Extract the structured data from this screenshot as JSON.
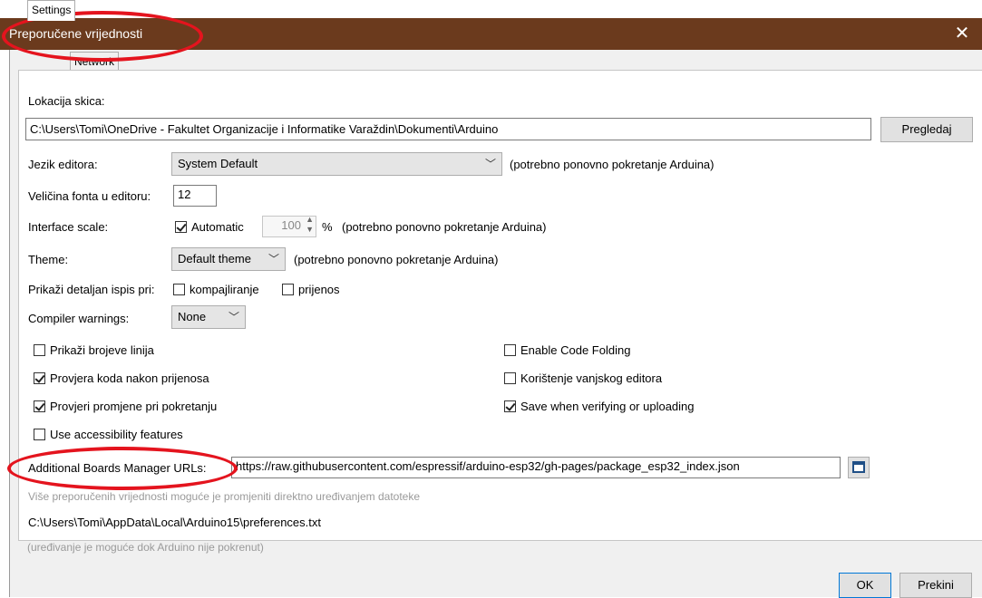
{
  "window": {
    "title": "Preporučene vrijednosti",
    "close_glyph": "✕"
  },
  "tabs": [
    {
      "label": "Settings",
      "selected": true
    },
    {
      "label": "Network",
      "selected": false
    }
  ],
  "settings": {
    "sketch_location_label": "Lokacija skica:",
    "sketch_location_value": "C:\\Users\\Tomi\\OneDrive - Fakultet Organizacije i Informatike Varaždin\\Dokumenti\\Arduino",
    "browse_button": "Pregledaj",
    "editor_language_label": "Jezik editora:",
    "editor_language_value": "System Default",
    "editor_language_note": "(potrebno ponovno pokretanje Arduina)",
    "font_size_label": "Veličina fonta u editoru:",
    "font_size_value": "12",
    "interface_scale_label": "Interface scale:",
    "interface_scale_auto_label": "Automatic",
    "interface_scale_auto_checked": true,
    "interface_scale_value": "100",
    "interface_scale_unit": "%",
    "interface_scale_note": "(potrebno ponovno pokretanje Arduina)",
    "theme_label": "Theme:",
    "theme_value": "Default theme",
    "theme_note": "(potrebno ponovno pokretanje Arduina)",
    "verbose_label": "Prikaži detaljan ispis pri:",
    "verbose_compile_label": "kompajliranje",
    "verbose_compile_checked": false,
    "verbose_upload_label": "prijenos",
    "verbose_upload_checked": false,
    "compiler_warnings_label": "Compiler warnings:",
    "compiler_warnings_value": "None",
    "options_left": [
      {
        "label": "Prikaži brojeve linija",
        "checked": false
      },
      {
        "label": "Provjera koda nakon prijenosa",
        "checked": true
      },
      {
        "label": "Provjeri promjene pri pokretanju",
        "checked": true
      },
      {
        "label": "Use accessibility features",
        "checked": false
      }
    ],
    "options_right": [
      {
        "label": "Enable Code Folding",
        "checked": false
      },
      {
        "label": "Korištenje vanjskog editora",
        "checked": false
      },
      {
        "label": "Save when verifying or uploading",
        "checked": true
      }
    ],
    "boards_urls_label": "Additional Boards Manager URLs:",
    "boards_urls_value": "https://raw.githubusercontent.com/espressif/arduino-esp32/gh-pages/package_esp32_index.json",
    "more_prefs_note": "Više preporučenih vrijednosti moguće je promjeniti direktno uređivanjem datoteke",
    "prefs_path": "C:\\Users\\Tomi\\AppData\\Local\\Arduino15\\preferences.txt",
    "edit_note": "(uređivanje je moguće dok Arduino nije pokrenut)"
  },
  "footer": {
    "ok_button": "OK",
    "cancel_button": "Prekini"
  },
  "colors": {
    "titlebar": "#6b3a1d",
    "annotation": "#e4141e"
  }
}
